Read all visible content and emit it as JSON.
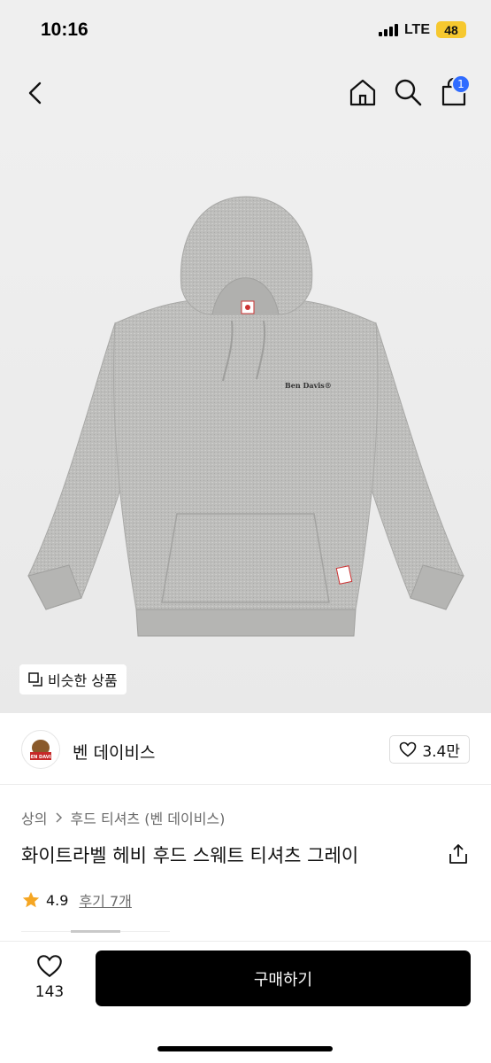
{
  "status_bar": {
    "time": "10:16",
    "network": "LTE",
    "battery": "48"
  },
  "nav": {
    "cart_count": "1"
  },
  "hero": {
    "similar_label": "비슷한 상품",
    "print_text": "Ben Davis®"
  },
  "brand": {
    "name": "벤 데이비스",
    "like_count": "3.4만",
    "logo_text": "BEN DAVIS"
  },
  "breadcrumb": {
    "items": [
      "상의",
      "후드 티셔츠 (벤 데이비스)"
    ]
  },
  "product": {
    "title": "화이트라벨 헤비 후드 스웨트 티셔츠 그레이",
    "rating": "4.9",
    "reviews": "후기 7개"
  },
  "bottom_bar": {
    "wish_count": "143",
    "buy_label": "구매하기"
  },
  "colors": {
    "accent_blue": "#2f6bff",
    "star": "#f5a623",
    "buy_button": "#000000",
    "battery": "#f6c82f"
  }
}
